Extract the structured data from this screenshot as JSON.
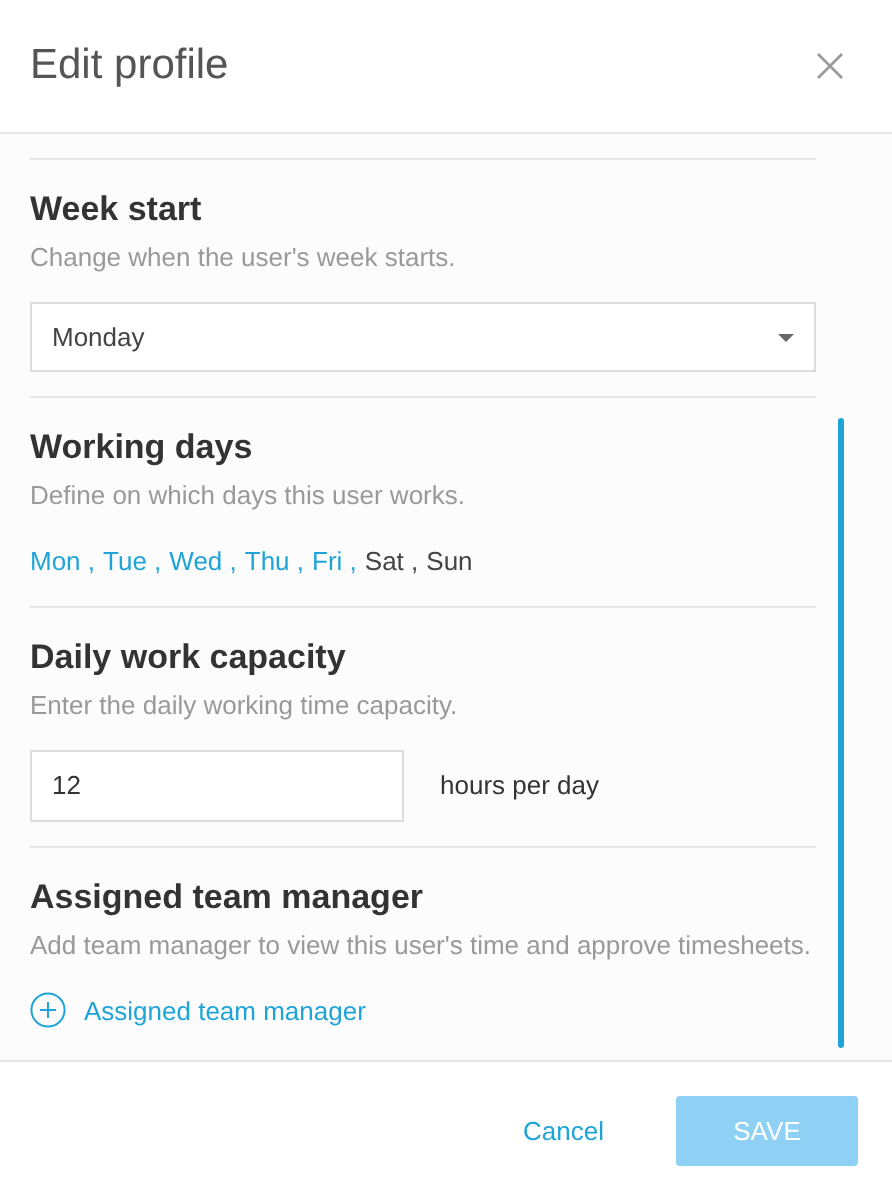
{
  "dialog": {
    "title": "Edit profile"
  },
  "week_start": {
    "heading": "Week start",
    "description": "Change when the user's week starts.",
    "value": "Monday"
  },
  "working_days": {
    "heading": "Working days",
    "description": "Define on which days this user works.",
    "days": [
      {
        "label": "Mon ,",
        "selected": true
      },
      {
        "label": "Tue ,",
        "selected": true
      },
      {
        "label": "Wed ,",
        "selected": true
      },
      {
        "label": "Thu ,",
        "selected": true
      },
      {
        "label": "Fri ,",
        "selected": true
      },
      {
        "label": "Sat ,",
        "selected": false
      },
      {
        "label": "Sun",
        "selected": false
      }
    ]
  },
  "capacity": {
    "heading": "Daily work capacity",
    "description": "Enter the daily working time capacity.",
    "value": "12",
    "unit": "hours per day"
  },
  "team_manager": {
    "heading": "Assigned team manager",
    "description": "Add team manager to view this user's time and approve timesheets.",
    "add_link": "Assigned team manager"
  },
  "footer": {
    "cancel": "Cancel",
    "save": {
      "label": "SAVE",
      "disabled": true
    }
  }
}
